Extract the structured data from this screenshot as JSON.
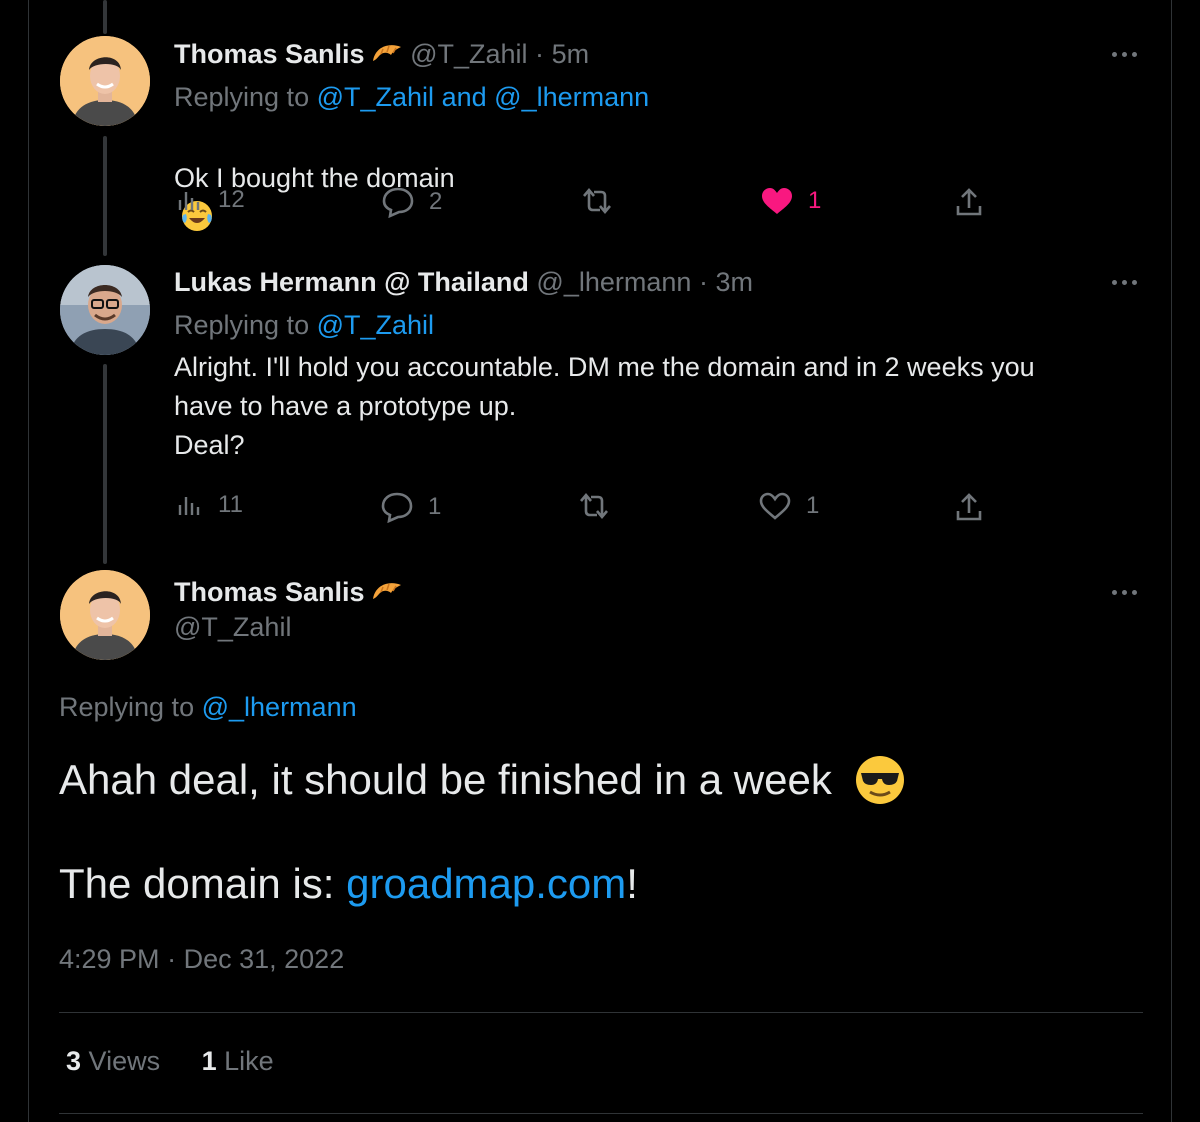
{
  "tweet1": {
    "name": "Thomas Sanlis",
    "handle": "@T_Zahil",
    "time": "5m",
    "replying_prefix": "Replying to",
    "reply_mentions_1": "@T_Zahil",
    "reply_and": "and",
    "reply_mentions_2": "@_lhermann",
    "text": "Ok I bought the domain",
    "views": "12",
    "replies": "2",
    "likes": "1",
    "liked": true,
    "badge_icon": "croissant-icon",
    "text_emoji": "tears-of-joy-emoji"
  },
  "tweet2": {
    "name": "Lukas Hermann @ Thailand",
    "handle": "@_lhermann",
    "time": "3m",
    "replying_prefix": "Replying to",
    "reply_mentions": "@T_Zahil",
    "text": "Alright. I'll hold you accountable. DM me the domain and in 2 weeks you\nhave to have a prototype up.\nDeal?",
    "views": "11",
    "replies": "1",
    "likes": "1",
    "liked": false
  },
  "main": {
    "name": "Thomas Sanlis",
    "handle": "@T_Zahil",
    "replying_prefix": "Replying to",
    "reply_mentions": "@_lhermann",
    "line1": "Ahah deal, it should be finished in a week",
    "line1_emoji": "sunglasses-emoji",
    "line2_prefix": "The domain is: ",
    "line2_link": "groadmap.com",
    "line2_suffix": "!",
    "timestamp": "4:29 PM",
    "date_sep": "·",
    "date": "Dec 31, 2022",
    "views_count": "3",
    "views_label": "Views",
    "likes_count": "1",
    "likes_label": "Like"
  },
  "colors": {
    "accent": "#1d9bf0",
    "like": "#f91880",
    "muted": "#71767b",
    "text": "#e7e9ea",
    "background": "#000000"
  }
}
